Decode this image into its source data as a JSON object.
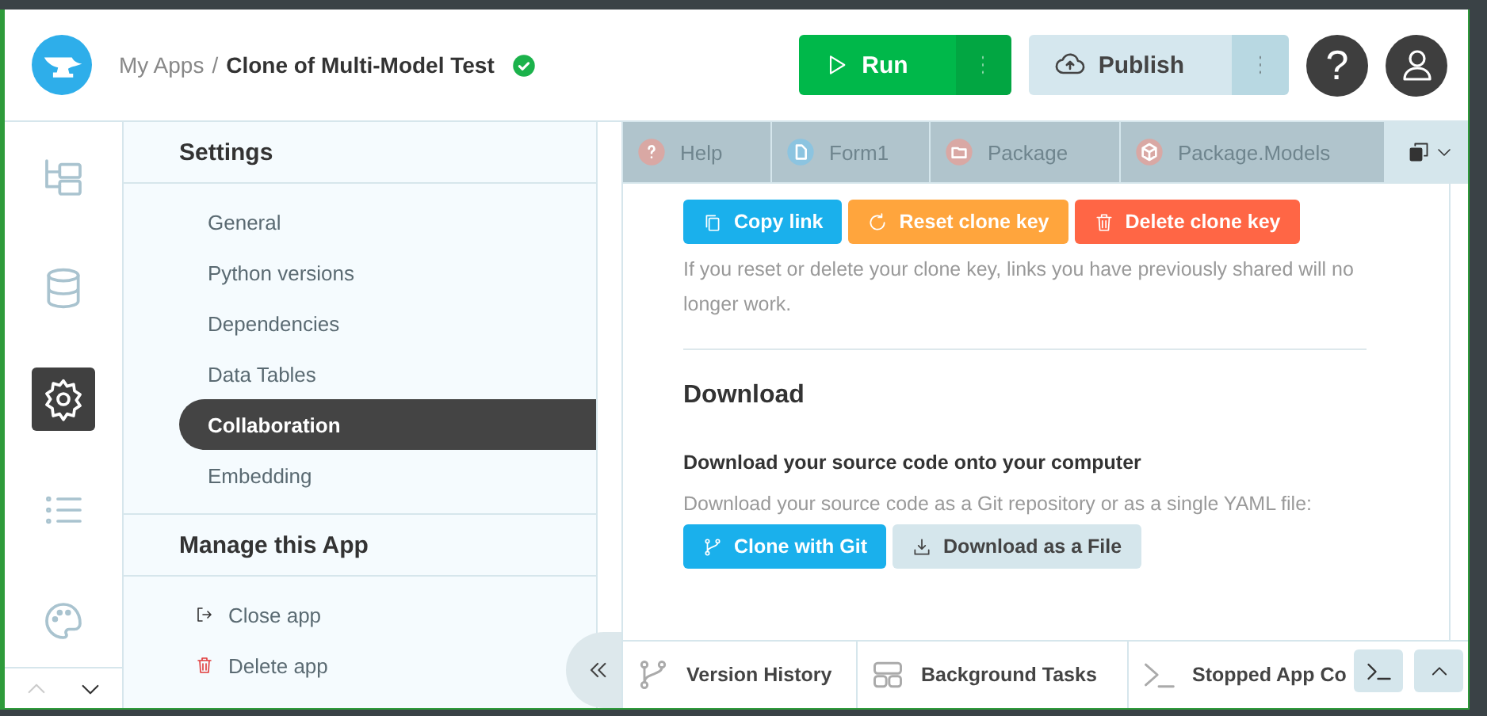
{
  "header": {
    "breadcrumb_root": "My Apps",
    "separator": "/",
    "app_name": "Clone of Multi-Model Test",
    "saved": true,
    "run_button": "Run",
    "publish_button": "Publish",
    "help_button": "?"
  },
  "rail": [
    {
      "kind": "tree",
      "selected": false
    },
    {
      "kind": "database",
      "selected": false
    },
    {
      "kind": "settings",
      "selected": true
    },
    {
      "kind": "list",
      "selected": false
    },
    {
      "kind": "palette",
      "selected": false
    }
  ],
  "settings": {
    "title": "Settings",
    "items": [
      {
        "label": "General",
        "selected": false
      },
      {
        "label": "Python versions",
        "selected": false
      },
      {
        "label": "Dependencies",
        "selected": false
      },
      {
        "label": "Data Tables",
        "selected": false
      },
      {
        "label": "Collaboration",
        "selected": true
      },
      {
        "label": "Embedding",
        "selected": false
      }
    ],
    "manage_title": "Manage this App",
    "actions": [
      {
        "kind": "close",
        "label": "Close app"
      },
      {
        "kind": "delete",
        "label": "Delete app"
      }
    ]
  },
  "tabs": [
    {
      "kind": "help",
      "label": "Help"
    },
    {
      "kind": "form",
      "label": "Form1"
    },
    {
      "kind": "package",
      "label": "Package"
    },
    {
      "kind": "module",
      "label": "Package.Models"
    }
  ],
  "content": {
    "clone_buttons": [
      {
        "kind": "copy",
        "label": "Copy link"
      },
      {
        "kind": "reset",
        "label": "Reset clone key"
      },
      {
        "kind": "delete",
        "label": "Delete clone key"
      }
    ],
    "clone_note": "If you reset or delete your clone key, links you have previously shared will no longer work.",
    "download_title": "Download",
    "download_subtitle": "Download your source code onto your computer",
    "download_note": "Download your source code as a Git repository or as a single YAML file:",
    "download_buttons": [
      {
        "kind": "git",
        "label": "Clone with Git"
      },
      {
        "kind": "file",
        "label": "Download as a File"
      }
    ]
  },
  "bottom_tabs": [
    {
      "kind": "history",
      "label": "Version History"
    },
    {
      "kind": "tasks",
      "label": "Background Tasks"
    },
    {
      "kind": "console",
      "label": "Stopped App Co"
    }
  ]
}
